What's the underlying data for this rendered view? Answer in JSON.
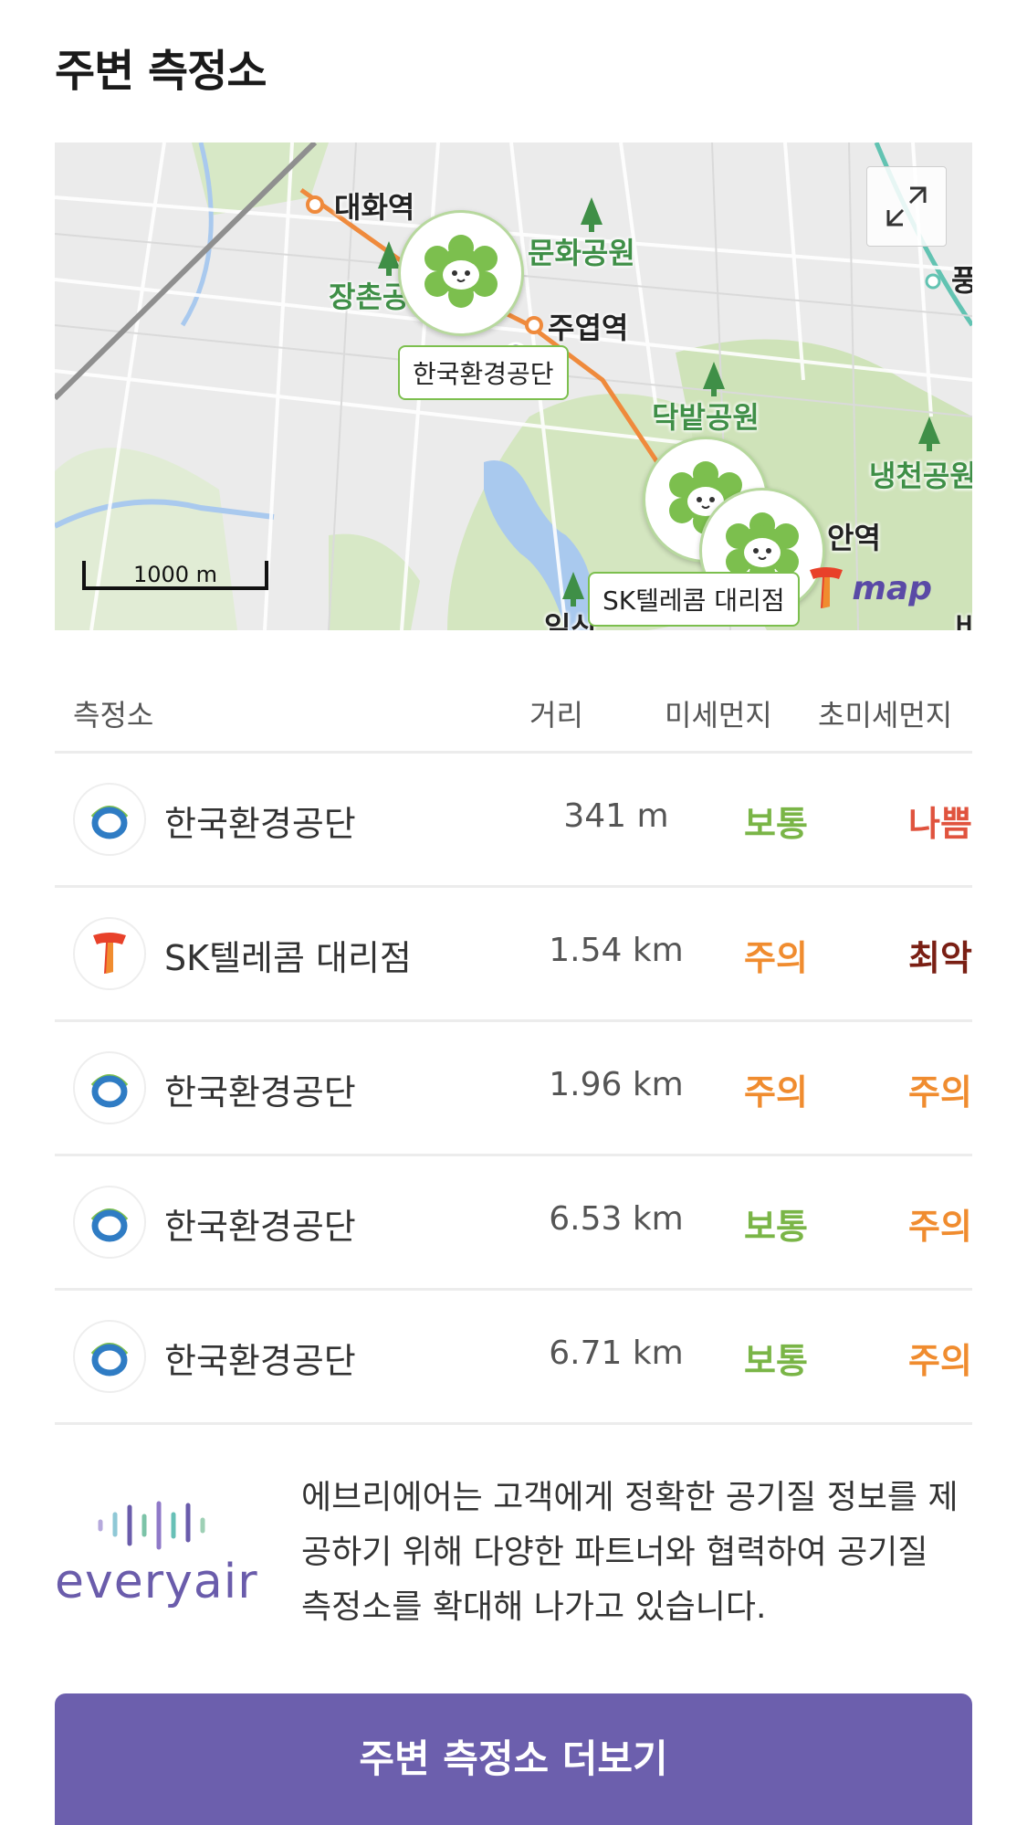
{
  "title": "주변 측정소",
  "map": {
    "scale_label": "1000 m",
    "logo_text": "map",
    "labels": {
      "daehwa": "대화역",
      "munhwa_park": "문화공원",
      "jangchon": "장촌공",
      "juyeop": "주엽역",
      "dakbat_park": "닥밭공원",
      "naengcheon_park": "냉천공원",
      "an_station": "안역",
      "right_edge": "풍",
      "bottom_left": "일산",
      "bottom_right": "비"
    },
    "pin_tags": {
      "pin1": "한국환경공단",
      "pin2": "SK텔레콤 대리점"
    },
    "colors": {
      "park": "#cfe4b8",
      "water": "#a9c9ee",
      "subway": "#ef8a3c",
      "rail": "#8f8f8f"
    }
  },
  "table": {
    "headers": {
      "station": "측정소",
      "distance": "거리",
      "pm10": "미세먼지",
      "pm25": "초미세먼지"
    },
    "rows": [
      {
        "name": "한국환경공단",
        "distance": "341 m",
        "pm10": "보통",
        "pm25": "나쁨",
        "logo": "keco-logo-icon"
      },
      {
        "name": "SK텔레콤 대리점",
        "distance": "1.54 km",
        "pm10": "주의",
        "pm25": "최악",
        "logo": "sk-telecom-logo-icon"
      },
      {
        "name": "한국환경공단",
        "distance": "1.96 km",
        "pm10": "주의",
        "pm25": "주의",
        "logo": "keco-logo-icon"
      },
      {
        "name": "한국환경공단",
        "distance": "6.53 km",
        "pm10": "보통",
        "pm25": "주의",
        "logo": "keco-logo-icon"
      },
      {
        "name": "한국환경공단",
        "distance": "6.71 km",
        "pm10": "보통",
        "pm25": "주의",
        "logo": "keco-logo-icon"
      }
    ],
    "status_colors": {
      "보통": "#7ab547",
      "주의": "#f08c2f",
      "나쁨": "#e0533e",
      "최악": "#7a1f14"
    }
  },
  "brand": {
    "name": "everyair"
  },
  "note": "에브리에어는 고객에게 정확한 공기질 정보를 제공하기 위해 다양한 파트너와 협력하여 공기질 측정소를 확대해 나가고 있습니다.",
  "more_button": "주변 측정소 더보기"
}
